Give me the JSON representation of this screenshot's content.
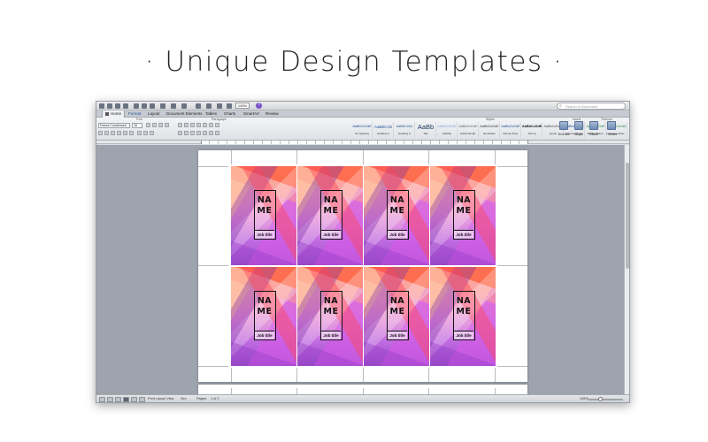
{
  "headline": "· Unique Design Templates ·",
  "toolbar": {
    "zoom": "145%",
    "search_placeholder": "Search in Document",
    "help_symbol": "?"
  },
  "tabs": [
    {
      "label": "Home"
    },
    {
      "label": "Format"
    },
    {
      "label": "Layout"
    },
    {
      "label": "Document Elements"
    },
    {
      "label": "Tables"
    },
    {
      "label": "Charts"
    },
    {
      "label": "SmartArt"
    },
    {
      "label": "Review"
    }
  ],
  "ribbon": {
    "font_group_label": "Font",
    "paragraph_group_label": "Paragraph",
    "styles_group_label": "Styles",
    "insert_group_label": "Insert",
    "themes_group_label": "Themes",
    "font_name": "Futura Condensed",
    "font_size": "16",
    "styles": [
      {
        "sample": "AaBbCcDdE",
        "name": "No Spacing"
      },
      {
        "sample": "AaBbCcD",
        "name": "Heading 2"
      },
      {
        "sample": "AaBbCcDc",
        "name": "Heading 3"
      },
      {
        "sample": "AaBb",
        "name": "Title"
      },
      {
        "sample": "AaBbCcDdE",
        "name": "Subtitle"
      },
      {
        "sample": "AaBbCcDdE",
        "name": "Subtle Emph."
      },
      {
        "sample": "AaBbCcDdE",
        "name": "Emphasis"
      },
      {
        "sample": "AaBbCcDdE",
        "name": "Intense Emp."
      },
      {
        "sample": "AaBbCcDdE",
        "name": "Strong"
      },
      {
        "sample": "AaBbCcDdE",
        "name": "Quote"
      },
      {
        "sample": "AaBbCcDdE",
        "name": "Intense Quote"
      },
      {
        "sample": "AaBbCcDdE",
        "name": "Subtle Refere."
      },
      {
        "sample": "AaBbCcDdE",
        "name": "Intense Refer."
      }
    ],
    "insert_buttons": [
      {
        "label": "Text Box"
      },
      {
        "label": "Shape"
      },
      {
        "label": "Picture"
      },
      {
        "label": "Themes"
      }
    ]
  },
  "cards": [
    {
      "name_line1": "NA",
      "name_line2": "ME",
      "job": "Job title"
    },
    {
      "name_line1": "NA",
      "name_line2": "ME",
      "job": "Job title"
    },
    {
      "name_line1": "NA",
      "name_line2": "ME",
      "job": "Job title"
    },
    {
      "name_line1": "NA",
      "name_line2": "ME",
      "job": "Job title"
    },
    {
      "name_line1": "NA",
      "name_line2": "ME",
      "job": "Job title"
    },
    {
      "name_line1": "NA",
      "name_line2": "ME",
      "job": "Job title"
    },
    {
      "name_line1": "NA",
      "name_line2": "ME",
      "job": "Job title"
    },
    {
      "name_line1": "NA",
      "name_line2": "ME",
      "job": "Job title"
    }
  ],
  "status": {
    "view": "Print Layout View",
    "sec": "Sec",
    "pages_label": "Pages:",
    "pages": "1 of 2",
    "zoom": "145%"
  }
}
